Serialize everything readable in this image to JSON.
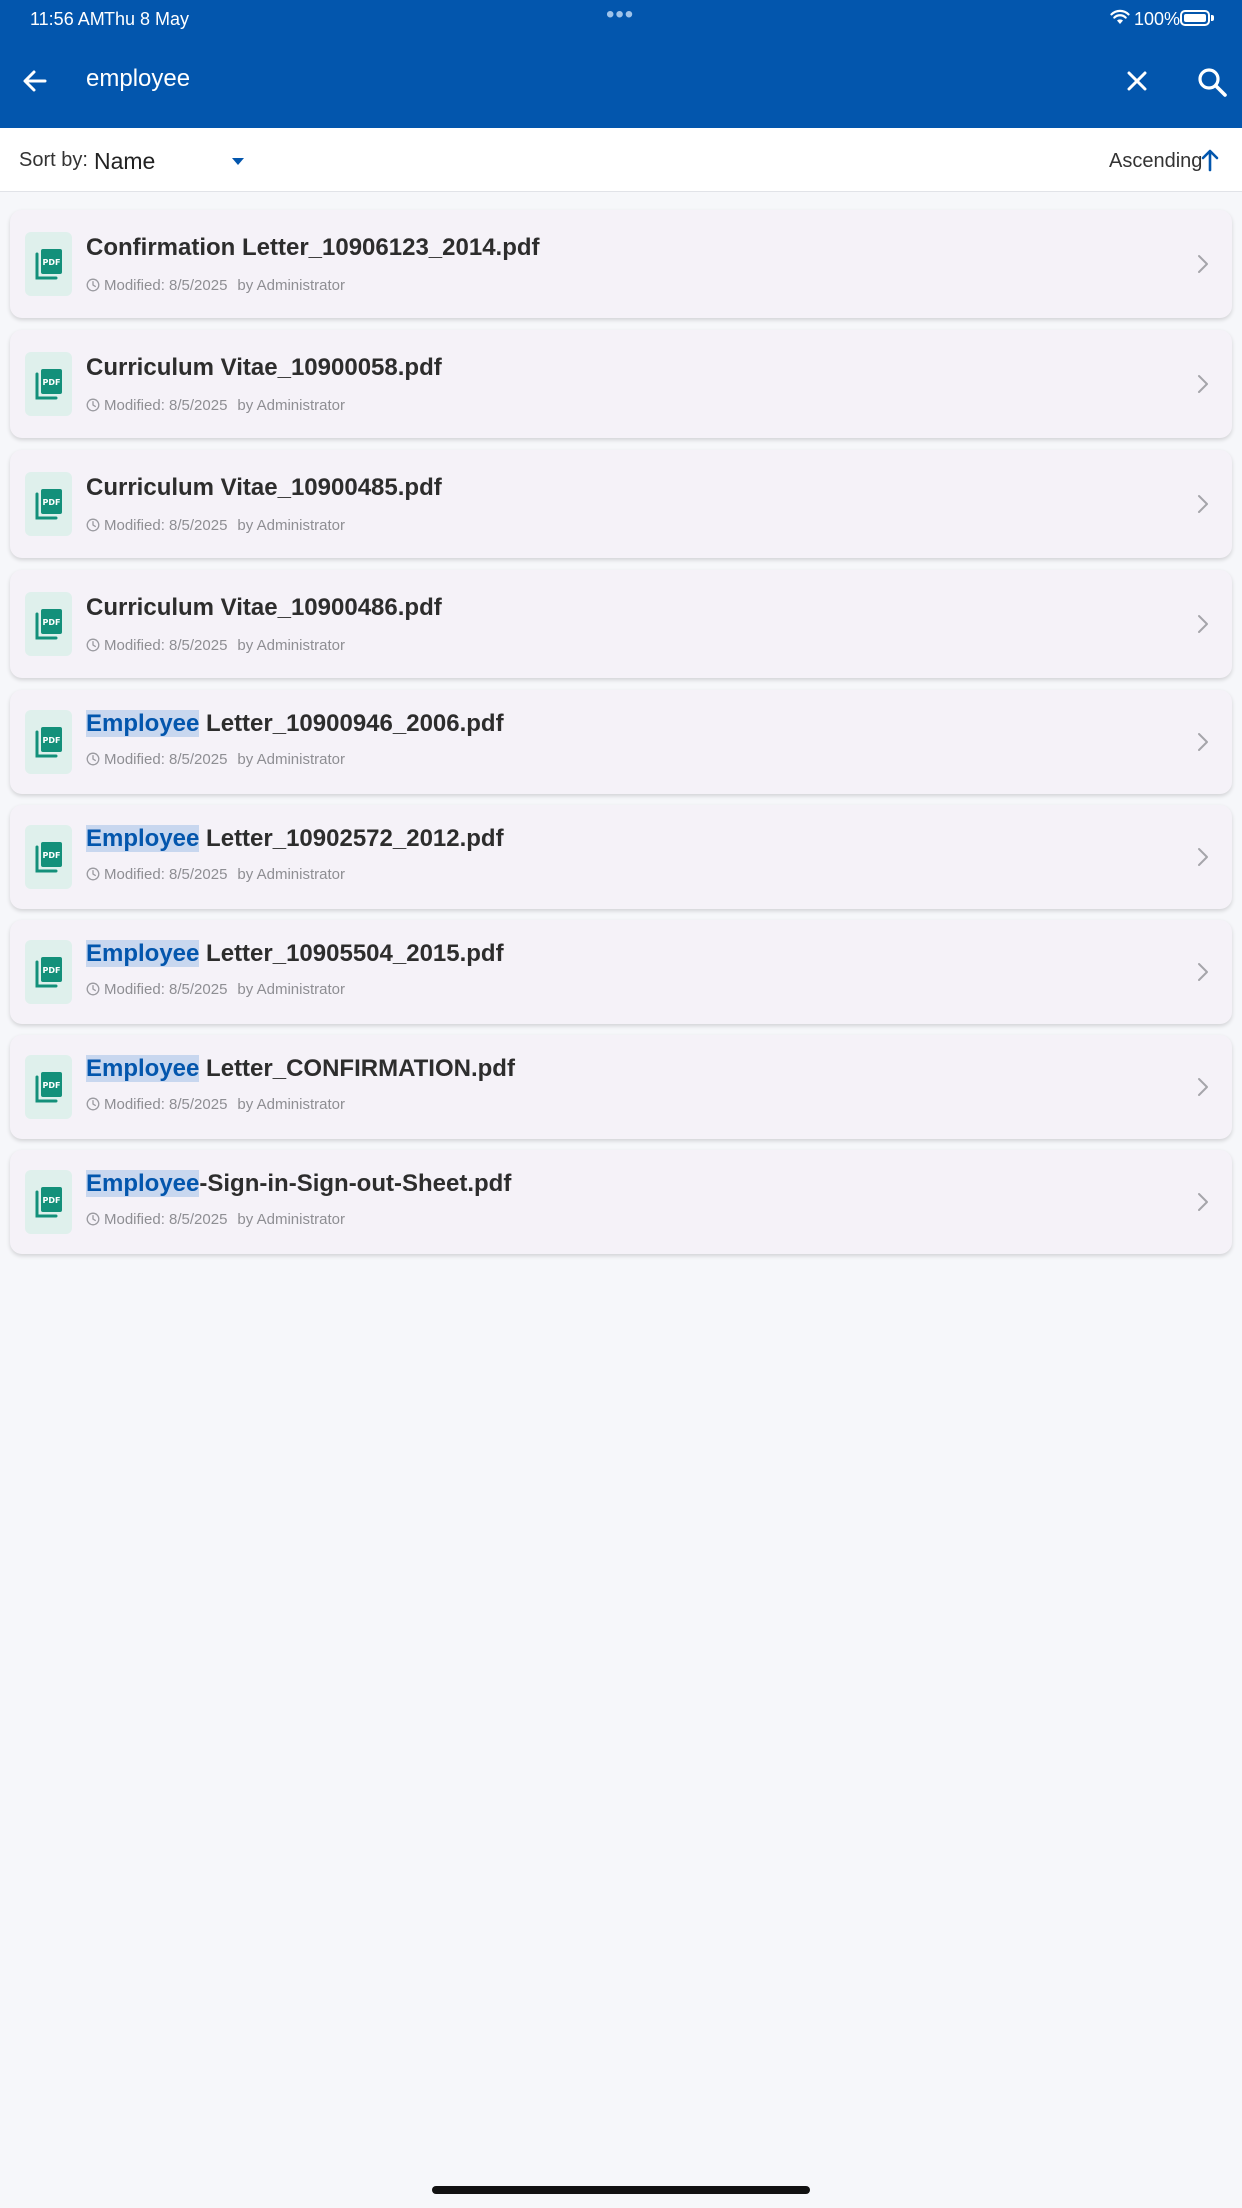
{
  "status_bar": {
    "time": "11:56 AM",
    "date": "Thu 8 May",
    "dots": "•••",
    "battery_pct": "100%"
  },
  "search": {
    "query": "employee",
    "back_icon": "arrow-left-icon",
    "clear_icon": "close-icon",
    "search_icon": "search-icon"
  },
  "sort": {
    "label": "Sort by:",
    "value": "Name",
    "order": "Ascending"
  },
  "colors": {
    "brand": "#0356ad",
    "highlight_bg": "#c8d7ef",
    "pdf_icon": "#13907a"
  },
  "files": [
    {
      "highlight": "",
      "rest": "Confirmation Letter_10906123_2014.pdf",
      "modified": "Modified: 8/5/2025",
      "by": "by Administrator"
    },
    {
      "highlight": "",
      "rest": "Curriculum Vitae_10900058.pdf",
      "modified": "Modified: 8/5/2025",
      "by": "by Administrator"
    },
    {
      "highlight": "",
      "rest": "Curriculum Vitae_10900485.pdf",
      "modified": "Modified: 8/5/2025",
      "by": "by Administrator"
    },
    {
      "highlight": "",
      "rest": "Curriculum Vitae_10900486.pdf",
      "modified": "Modified: 8/5/2025",
      "by": "by Administrator"
    },
    {
      "highlight": "Employee",
      "rest": " Letter_10900946_2006.pdf",
      "modified": "Modified: 8/5/2025",
      "by": "by Administrator"
    },
    {
      "highlight": "Employee",
      "rest": " Letter_10902572_2012.pdf",
      "modified": "Modified: 8/5/2025",
      "by": "by Administrator"
    },
    {
      "highlight": "Employee",
      "rest": " Letter_10905504_2015.pdf",
      "modified": "Modified: 8/5/2025",
      "by": "by Administrator"
    },
    {
      "highlight": "Employee",
      "rest": " Letter_CONFIRMATION.pdf",
      "modified": "Modified: 8/5/2025",
      "by": "by Administrator"
    },
    {
      "highlight": "Employee",
      "rest": "-Sign-in-Sign-out-Sheet.pdf",
      "modified": "Modified: 8/5/2025",
      "by": "by Administrator"
    }
  ]
}
